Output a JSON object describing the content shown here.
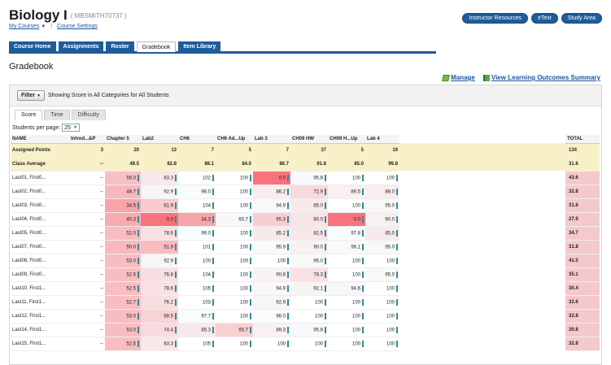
{
  "course": {
    "title": "Biology I",
    "id": "( MBSMITH70737 )",
    "my_courses": "My Courses",
    "course_settings": "Course Settings"
  },
  "top_buttons": [
    "Instructor Resources",
    "eText",
    "Study Area"
  ],
  "nav_tabs": [
    {
      "label": "Course Home",
      "active": false
    },
    {
      "label": "Assignments",
      "active": false
    },
    {
      "label": "Roster",
      "active": false
    },
    {
      "label": "Gradebook",
      "active": true
    },
    {
      "label": "Item Library",
      "active": false
    }
  ],
  "page_heading": "Gradebook",
  "links": {
    "manage": "Manage",
    "outcomes": "View Learning Outcomes Summary"
  },
  "filter": {
    "button": "Filter",
    "text": "Showing Score in All Categories for All Students"
  },
  "sub_tabs": [
    {
      "label": "Score",
      "active": true
    },
    {
      "label": "Time",
      "active": false
    },
    {
      "label": "Difficulty",
      "active": false
    }
  ],
  "per_page": {
    "label": "Students per page:",
    "value": "25"
  },
  "colors": {
    "accent": "#1e5c9a",
    "summary_bg": "#f8f1c8",
    "total_bg": "#f5c9cb",
    "score_bar": "#58b6c4"
  },
  "table": {
    "columns": [
      "NAME",
      "Introd...&P",
      "Chapter 5",
      "Lab2",
      "CH6",
      "CH6 Ad...Up",
      "Lab 3",
      "CH09 HW",
      "CH09 H...Up",
      "Lab 4"
    ],
    "total_header": "TOTAL",
    "summary_rows": [
      {
        "name": "Assigned Points",
        "cells": [
          "3",
          "20",
          "13",
          "7",
          "5",
          "7",
          "37",
          "5",
          "19"
        ],
        "total": "134"
      },
      {
        "name": "Class Average",
        "cells": [
          "--",
          "49.5",
          "82.8",
          "88.1",
          "84.0",
          "86.7",
          "91.8",
          "85.0",
          "99.8"
        ],
        "total": "31.6"
      }
    ],
    "rows": [
      {
        "name": "Last01, First0...",
        "cells": [
          "--",
          "55.0",
          "83.3",
          "102",
          "100",
          "0.0",
          "95.8",
          "100",
          "100"
        ],
        "total": "43.6"
      },
      {
        "name": "Last02, First0...",
        "cells": [
          "--",
          "48.7",
          "92.9",
          "98.0",
          "100",
          "86.2",
          "72.9",
          "89.5",
          "88.0"
        ],
        "total": "32.8"
      },
      {
        "name": "Last03, First0...",
        "cells": [
          "--",
          "34.5",
          "61.9",
          "104",
          "100",
          "94.9",
          "85.0",
          "100",
          "95.0"
        ],
        "total": "31.6"
      },
      {
        "name": "Last04, First0...",
        "cells": [
          "--",
          "40.3",
          "0.0",
          "34.3",
          "93.7",
          "65.3",
          "80.0",
          "0.0",
          "90.0"
        ],
        "total": "27.9"
      },
      {
        "name": "Last05, First0...",
        "cells": [
          "--",
          "52.0",
          "78.6",
          "99.0",
          "100",
          "85.2",
          "82.5",
          "97.8",
          "85.0"
        ],
        "total": "34.7"
      },
      {
        "name": "Last07, First0...",
        "cells": [
          "--",
          "50.0",
          "51.9",
          "101",
          "100",
          "95.9",
          "90.0",
          "96.1",
          "95.0"
        ],
        "total": "31.8"
      },
      {
        "name": "Last08, First0...",
        "cells": [
          "--",
          "53.0",
          "92.9",
          "100",
          "100",
          "100",
          "95.0",
          "100",
          "100"
        ],
        "total": "41.5"
      },
      {
        "name": "Last09, First0...",
        "cells": [
          "--",
          "52.5",
          "76.8",
          "104",
          "100",
          "90.8",
          "78.3",
          "100",
          "95.0"
        ],
        "total": "35.1"
      },
      {
        "name": "Last10, First1...",
        "cells": [
          "--",
          "52.5",
          "78.6",
          "105",
          "100",
          "94.9",
          "92.1",
          "94.6",
          "100"
        ],
        "total": "30.4"
      },
      {
        "name": "Last11, First1...",
        "cells": [
          "--",
          "52.7",
          "76.2",
          "103",
          "100",
          "92.9",
          "100",
          "100",
          "100"
        ],
        "total": "32.6"
      },
      {
        "name": "Last12, First1...",
        "cells": [
          "--",
          "53.0",
          "68.5",
          "97.7",
          "100",
          "98.0",
          "100",
          "100",
          "100"
        ],
        "total": "32.8"
      },
      {
        "name": "Last14, First1...",
        "cells": [
          "--",
          "53.0",
          "74.4",
          "85.3",
          "65.7",
          "89.3",
          "95.8",
          "100",
          "100"
        ],
        "total": "30.8"
      },
      {
        "name": "Last15, First1...",
        "cells": [
          "--",
          "52.5",
          "83.3",
          "105",
          "100",
          "100",
          "100",
          "100",
          "100"
        ],
        "total": "32.8"
      }
    ]
  }
}
